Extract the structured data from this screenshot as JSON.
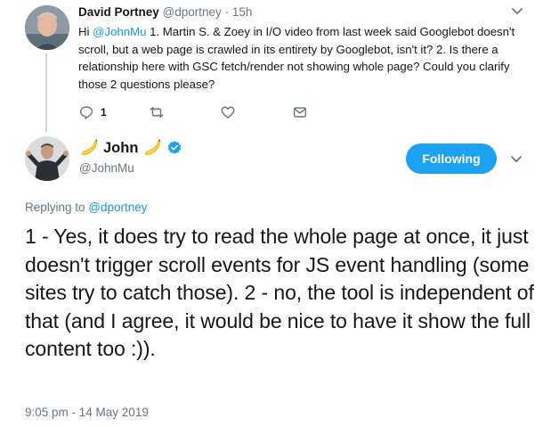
{
  "parent_tweet": {
    "display_name": "David Portney",
    "handle": "@dportney",
    "separator": "·",
    "time_ago": "15h",
    "text_prefix": "Hi ",
    "mention": "@JohnMu",
    "text_body": " 1. Martin S. & Zoey in I/O video from last week said Googlebot doesn't scroll, but a web page is crawled in its entirety by Googlebot, isn't it? 2. Is there a relationship here with GSC fetch/render not showing whole page? Could you clarify those 2 questions please?",
    "actions": {
      "reply_icon": "reply-icon",
      "reply_count": "1",
      "retweet_icon": "retweet-icon",
      "like_icon": "heart-icon",
      "dm_icon": "envelope-icon"
    }
  },
  "main_tweet": {
    "display_name": "John",
    "name_emoji": "banana-icon",
    "verified_icon": "verified-badge-icon",
    "handle": "@JohnMu",
    "follow_button": "Following",
    "reply_label": "Replying to ",
    "reply_mention": "@dportney",
    "text": "1 - Yes, it does try to read the whole page at once, it just doesn't trigger scroll events for JS event handling (some sites try to catch those). 2 - no, the tool is independent of that (and I agree, it would be nice to have it show the full content too :)).",
    "timestamp": "9:05 pm - 14 May 2019"
  },
  "colors": {
    "accent": "#1da1f2",
    "link": "#1b95e0",
    "muted": "#657786",
    "text": "#14171a"
  }
}
